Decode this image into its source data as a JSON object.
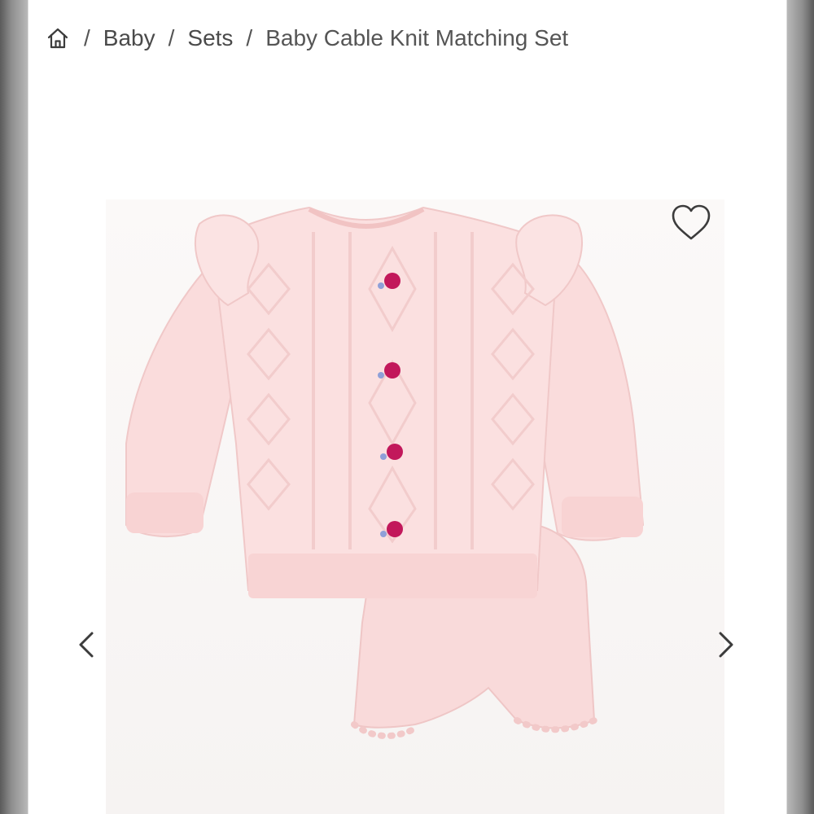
{
  "breadcrumb": {
    "home_icon": "home-icon",
    "separator": "/",
    "items": [
      "Baby",
      "Sets"
    ],
    "current": "Baby Cable Knit Matching Set"
  },
  "gallery": {
    "favorite_icon": "heart-outline-icon",
    "prev_icon": "chevron-left-icon",
    "next_icon": "chevron-right-icon",
    "product_image": "pink cable knit sweater with embroidered roses and matching bloomers"
  },
  "colors": {
    "knit_pink": "#f9dcdc",
    "rose": "#c2185b",
    "text": "#4a4a4a",
    "icon": "#3c3c3c"
  }
}
